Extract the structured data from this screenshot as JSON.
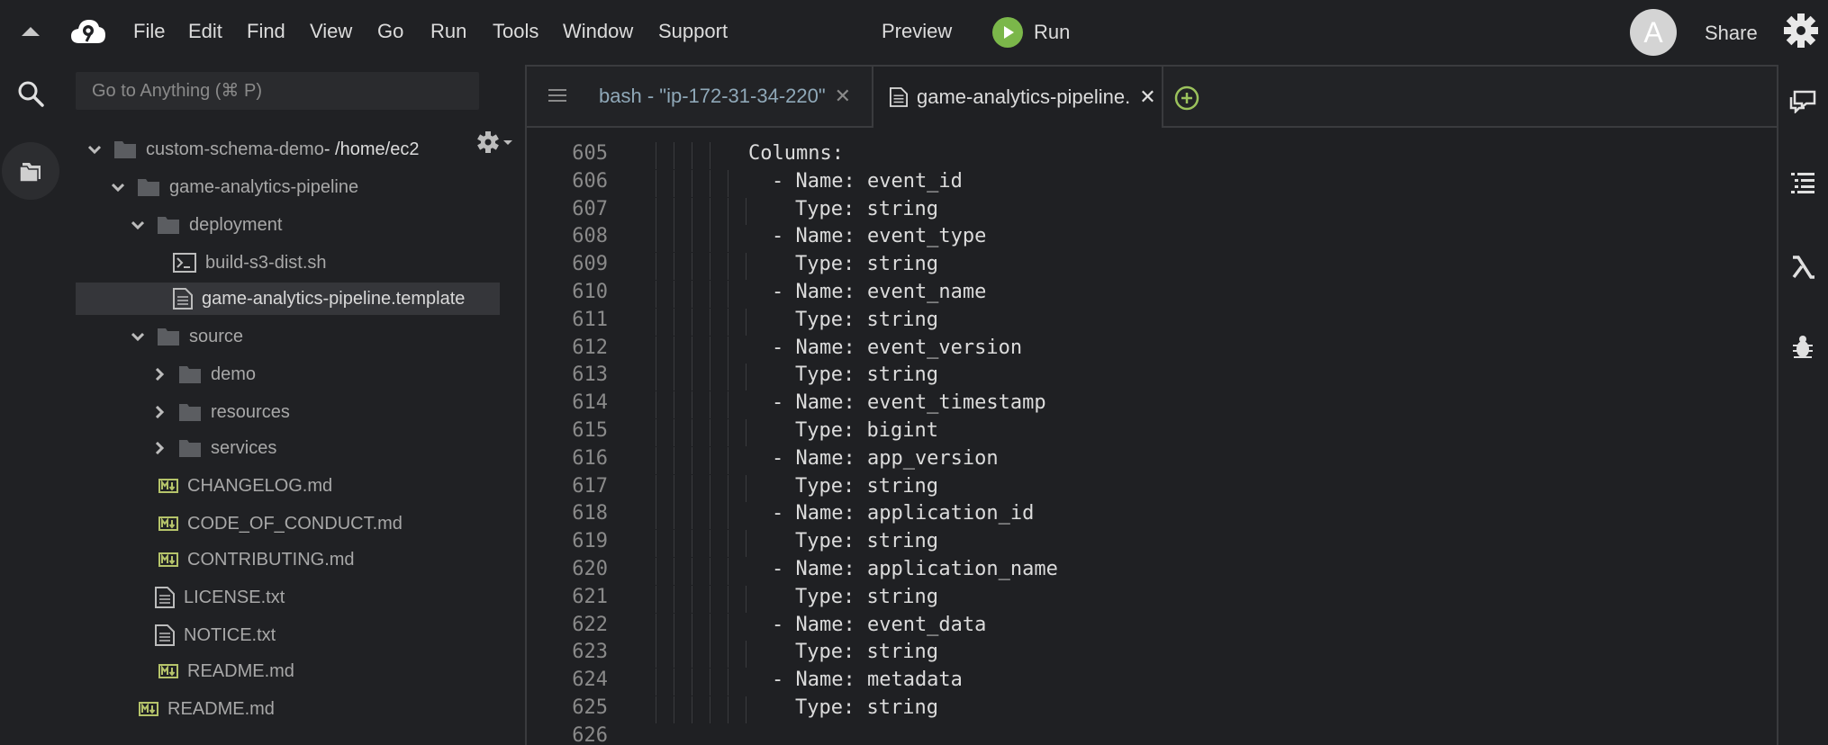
{
  "menubar": {
    "items": [
      "File",
      "Edit",
      "Find",
      "View",
      "Go",
      "Run",
      "Tools",
      "Window",
      "Support"
    ],
    "preview_label": "Preview",
    "run_label": "Run",
    "avatar_initial": "A",
    "share_label": "Share",
    "run_color": "#7bb74a"
  },
  "sidebar": {
    "search_placeholder": "Go to Anything (⌘ P)",
    "tree": [
      {
        "label": "custom-schema-demo",
        "suffix": " - /home/ec2",
        "type": "folder",
        "expanded": true,
        "depth": 0
      },
      {
        "label": "game-analytics-pipeline",
        "type": "folder",
        "expanded": true,
        "depth": 1
      },
      {
        "label": "deployment",
        "type": "folder",
        "expanded": true,
        "depth": 2
      },
      {
        "label": "build-s3-dist.sh",
        "type": "shell",
        "depth": 3
      },
      {
        "label": "game-analytics-pipeline.template",
        "type": "doc",
        "depth": 3,
        "selected": true
      },
      {
        "label": "source",
        "type": "folder",
        "expanded": true,
        "depth": 2
      },
      {
        "label": "demo",
        "type": "folder",
        "expanded": false,
        "depth": 3
      },
      {
        "label": "resources",
        "type": "folder",
        "expanded": false,
        "depth": 3
      },
      {
        "label": "services",
        "type": "folder",
        "expanded": false,
        "depth": 3
      },
      {
        "label": "CHANGELOG.md",
        "type": "md",
        "depth": 2
      },
      {
        "label": "CODE_OF_CONDUCT.md",
        "type": "md",
        "depth": 2
      },
      {
        "label": "CONTRIBUTING.md",
        "type": "md",
        "depth": 2
      },
      {
        "label": "LICENSE.txt",
        "type": "doc",
        "depth": 2
      },
      {
        "label": "NOTICE.txt",
        "type": "doc",
        "depth": 2
      },
      {
        "label": "README.md",
        "type": "md",
        "depth": 2
      },
      {
        "label": "README.md",
        "type": "md",
        "depth": 1
      }
    ]
  },
  "editor": {
    "tabs": [
      {
        "label": "bash - \"ip-172-31-34-220\"",
        "active": false
      },
      {
        "label": "game-analytics-pipeline.",
        "active": true
      }
    ],
    "lines": [
      {
        "n": "605",
        "text": "Columns:",
        "indent": 4
      },
      {
        "n": "606",
        "text": "- Name: event_id",
        "indent": 5
      },
      {
        "n": "607",
        "text": "Type: string",
        "indent": 6
      },
      {
        "n": "608",
        "text": "- Name: event_type",
        "indent": 5
      },
      {
        "n": "609",
        "text": "Type: string",
        "indent": 6
      },
      {
        "n": "610",
        "text": "- Name: event_name",
        "indent": 5
      },
      {
        "n": "611",
        "text": "Type: string",
        "indent": 6
      },
      {
        "n": "612",
        "text": "- Name: event_version",
        "indent": 5
      },
      {
        "n": "613",
        "text": "Type: string",
        "indent": 6
      },
      {
        "n": "614",
        "text": "- Name: event_timestamp",
        "indent": 5
      },
      {
        "n": "615",
        "text": "Type: bigint",
        "indent": 6
      },
      {
        "n": "616",
        "text": "- Name: app_version",
        "indent": 5
      },
      {
        "n": "617",
        "text": "Type: string",
        "indent": 6
      },
      {
        "n": "618",
        "text": "- Name: application_id",
        "indent": 5
      },
      {
        "n": "619",
        "text": "Type: string",
        "indent": 6
      },
      {
        "n": "620",
        "text": "- Name: application_name",
        "indent": 5
      },
      {
        "n": "621",
        "text": "Type: string",
        "indent": 6
      },
      {
        "n": "622",
        "text": "- Name: event_data",
        "indent": 5
      },
      {
        "n": "623",
        "text": "Type: string",
        "indent": 6
      },
      {
        "n": "624",
        "text": "- Name: metadata",
        "indent": 5
      },
      {
        "n": "625",
        "text": "Type: string",
        "indent": 6
      },
      {
        "n": "626",
        "text": "",
        "indent": 0
      }
    ]
  },
  "right_rail": {
    "icons": [
      "chat-icon",
      "outline-icon",
      "lambda-icon",
      "debugger-icon"
    ]
  }
}
